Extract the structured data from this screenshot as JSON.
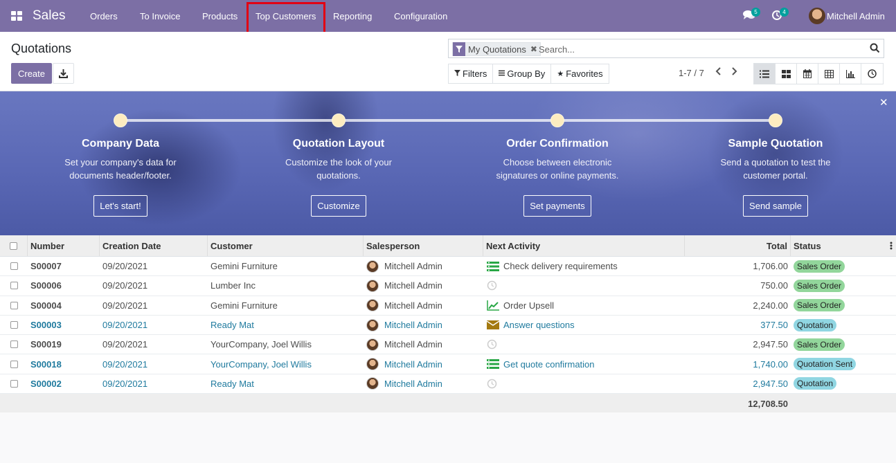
{
  "navbar": {
    "brand": "Sales",
    "menu": [
      {
        "label": "Orders"
      },
      {
        "label": "To Invoice"
      },
      {
        "label": "Products"
      },
      {
        "label": "Top Customers"
      },
      {
        "label": "Reporting"
      },
      {
        "label": "Configuration"
      }
    ],
    "messages_count": "5",
    "activities_count": "4",
    "user_name": "Mitchell Admin"
  },
  "control": {
    "title": "Quotations",
    "create_label": "Create",
    "facet_label": "My Quotations",
    "search_placeholder": "Search...",
    "filters_label": "Filters",
    "groupby_label": "Group By",
    "favorites_label": "Favorites",
    "pager": "1-7 / 7"
  },
  "banner": {
    "steps": [
      {
        "title": "Company Data",
        "desc1": "Set your company's data for",
        "desc2": "documents header/footer.",
        "button": "Let's start!"
      },
      {
        "title": "Quotation Layout",
        "desc1": "Customize the look of your",
        "desc2": "quotations.",
        "button": "Customize"
      },
      {
        "title": "Order Confirmation",
        "desc1": "Choose between electronic",
        "desc2": "signatures or online payments.",
        "button": "Set payments"
      },
      {
        "title": "Sample Quotation",
        "desc1": "Send a quotation to test the",
        "desc2": "customer portal.",
        "button": "Send sample"
      }
    ]
  },
  "table": {
    "headers": {
      "number": "Number",
      "creation_date": "Creation Date",
      "customer": "Customer",
      "salesperson": "Salesperson",
      "next_activity": "Next Activity",
      "total": "Total",
      "status": "Status"
    },
    "rows": [
      {
        "number": "S00007",
        "date": "09/20/2021",
        "customer": "Gemini Furniture",
        "salesperson": "Mitchell Admin",
        "activity": "Check delivery requirements",
        "activity_icon": "list-icon",
        "total": "1,706.00",
        "status": "Sales Order",
        "is_quotation": false
      },
      {
        "number": "S00006",
        "date": "09/20/2021",
        "customer": "Lumber Inc",
        "salesperson": "Mitchell Admin",
        "activity": "",
        "activity_icon": "clock-icon",
        "total": "750.00",
        "status": "Sales Order",
        "is_quotation": false
      },
      {
        "number": "S00004",
        "date": "09/20/2021",
        "customer": "Gemini Furniture",
        "salesperson": "Mitchell Admin",
        "activity": "Order Upsell",
        "activity_icon": "chart-line-icon",
        "total": "2,240.00",
        "status": "Sales Order",
        "is_quotation": false
      },
      {
        "number": "S00003",
        "date": "09/20/2021",
        "customer": "Ready Mat",
        "salesperson": "Mitchell Admin",
        "activity": "Answer questions",
        "activity_icon": "envelope-icon",
        "total": "377.50",
        "status": "Quotation",
        "is_quotation": true
      },
      {
        "number": "S00019",
        "date": "09/20/2021",
        "customer": "YourCompany, Joel Willis",
        "salesperson": "Mitchell Admin",
        "activity": "",
        "activity_icon": "clock-icon",
        "total": "2,947.50",
        "status": "Sales Order",
        "is_quotation": false
      },
      {
        "number": "S00018",
        "date": "09/20/2021",
        "customer": "YourCompany, Joel Willis",
        "salesperson": "Mitchell Admin",
        "activity": "Get quote confirmation",
        "activity_icon": "list-icon",
        "total": "1,740.00",
        "status": "Quotation Sent",
        "is_quotation": true
      },
      {
        "number": "S00002",
        "date": "09/20/2021",
        "customer": "Ready Mat",
        "salesperson": "Mitchell Admin",
        "activity": "",
        "activity_icon": "clock-icon",
        "total": "2,947.50",
        "status": "Quotation",
        "is_quotation": true
      }
    ],
    "grand_total": "12,708.50"
  },
  "colors": {
    "brand": "#7c6fa5",
    "link": "#1f7a9e",
    "status_sales_order": "#92d69b",
    "status_quotation": "#90d6e2",
    "highlight_box": "#e30013"
  }
}
